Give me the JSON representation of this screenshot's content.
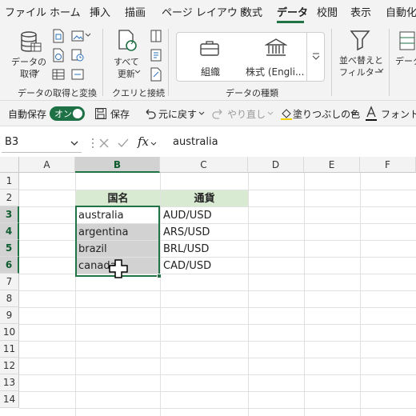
{
  "menu": {
    "tabs": [
      "ファイル",
      "ホーム",
      "挿入",
      "描画",
      "ページ レイアウト",
      "数式",
      "データ",
      "校閲",
      "表示",
      "自動化"
    ],
    "active": "データ"
  },
  "ribbon": {
    "get_data_label": "データの\n取得",
    "group_get": "データの取得と変換",
    "refresh_label": "すべて\n更新",
    "group_query": "クエリと接続",
    "type_org": "組織",
    "type_stock": "株式 (Engli...",
    "group_types": "データの種類",
    "sort_filter": "並べ替えと\nフィルター",
    "data_tools": "データ"
  },
  "qat": {
    "autosave": "自動保存",
    "toggle": "オン",
    "save": "保存",
    "undo": "元に戻す",
    "redo": "やり直し",
    "fill": "塗りつぶしの色",
    "font": "フォント"
  },
  "formula_bar": {
    "namebox": "B3",
    "fx": "fx",
    "content": "australia"
  },
  "grid": {
    "columns": [
      "A",
      "B",
      "C",
      "D",
      "E",
      "F"
    ],
    "rows": [
      "1",
      "2",
      "3",
      "4",
      "5",
      "6",
      "7",
      "8",
      "9",
      "10",
      "11",
      "12",
      "13",
      "14"
    ],
    "header_b": "国名",
    "header_c": "通貨",
    "b3": "australia",
    "b4": "argentina",
    "b5": "brazil",
    "b6": "canada",
    "c3": "AUD/USD",
    "c4": "ARS/USD",
    "c5": "BRL/USD",
    "c6": "CAD/USD"
  },
  "colors": {
    "accent": "#217346",
    "header_fill": "#d9ead3",
    "selection": "#d2d2d2"
  }
}
